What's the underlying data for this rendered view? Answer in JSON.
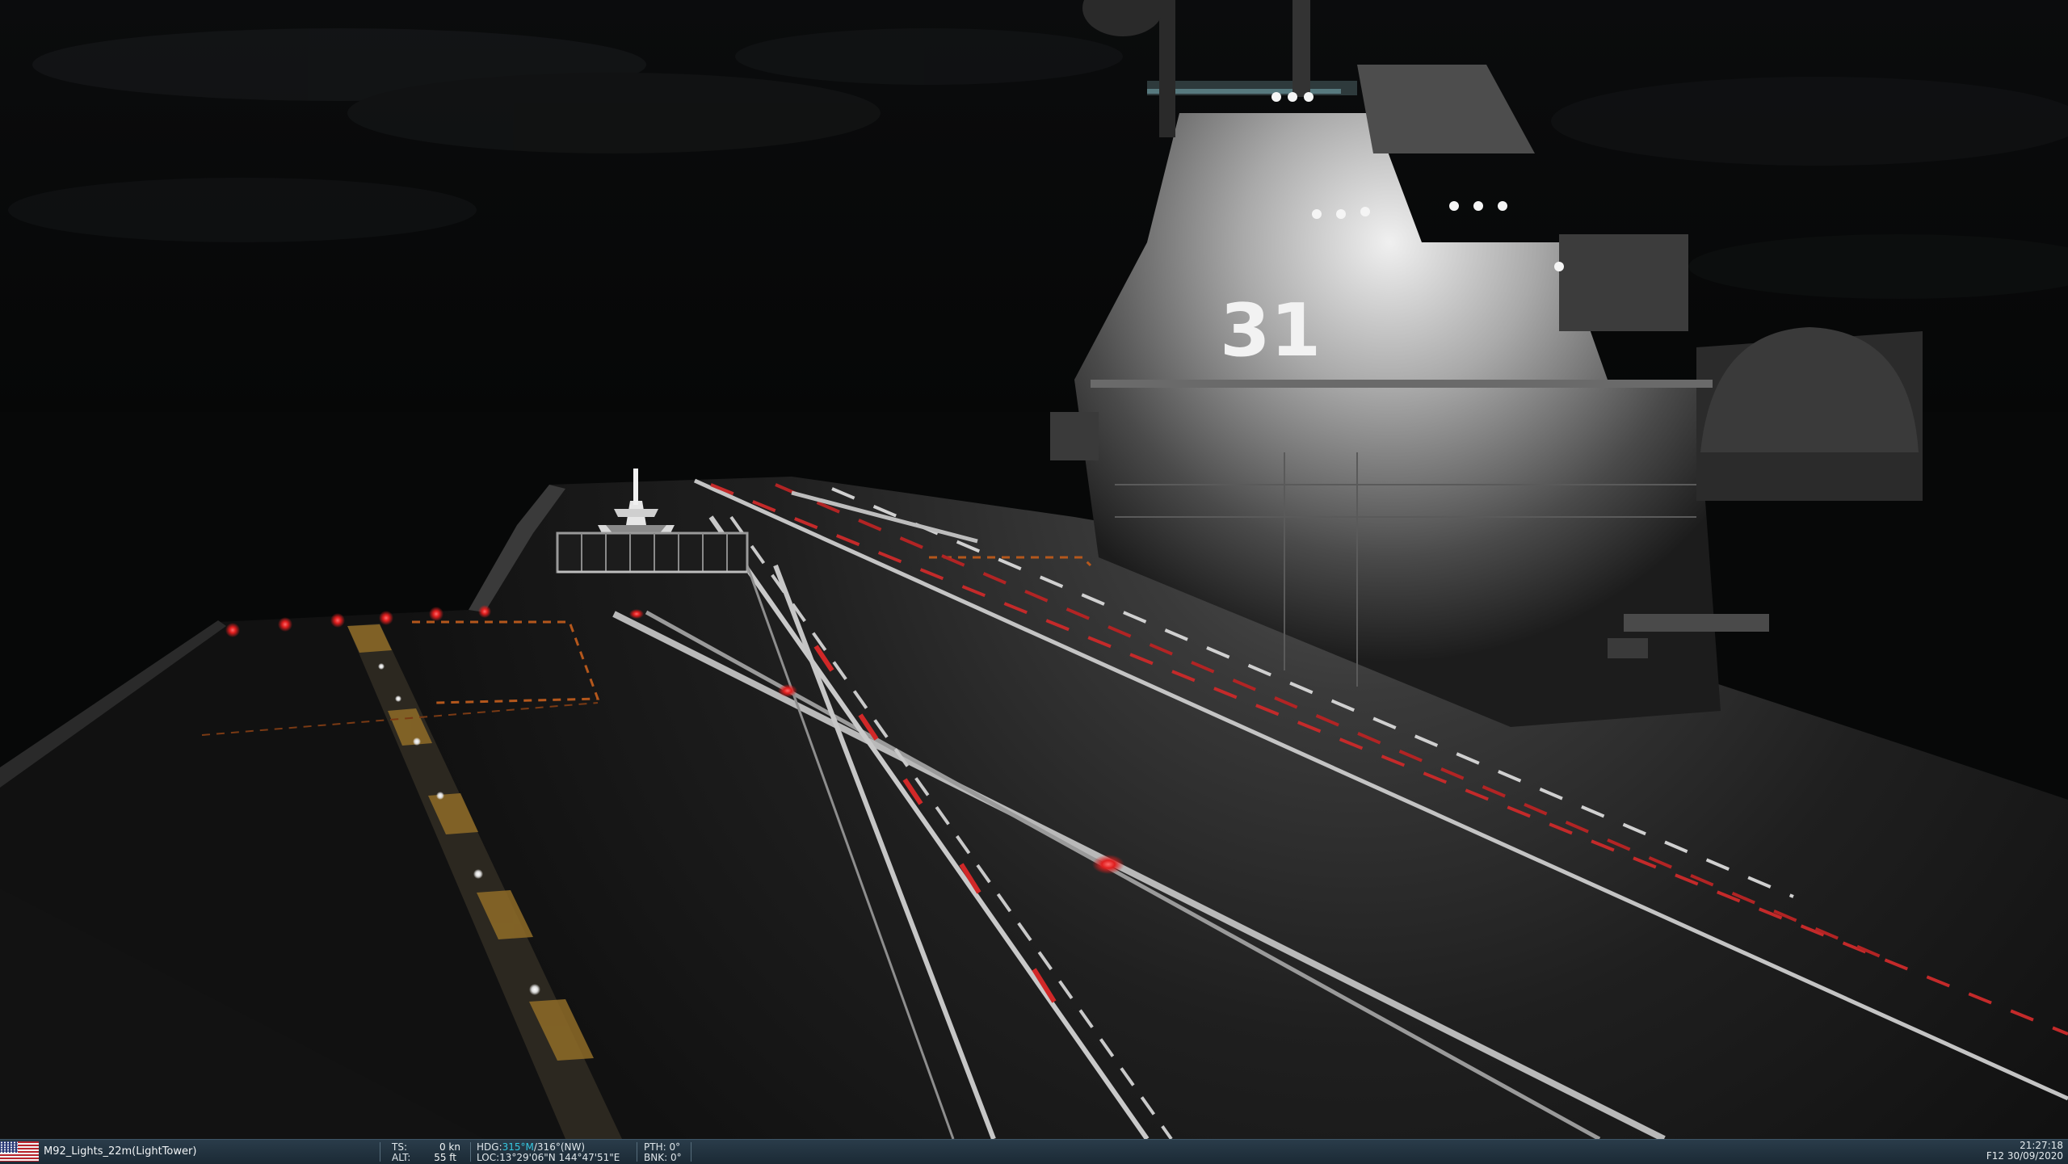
{
  "scene": {
    "hull_number": "31"
  },
  "status_bar": {
    "mission_text": "M92_Lights_22m(LightTower)",
    "ts_label": "TS:",
    "ts_value": "0 kn",
    "alt_label": "ALT:",
    "alt_value": "55 ft",
    "hdg_label": "HDG:",
    "hdg_magnetic": "315°M",
    "hdg_true": "/316°(NW)",
    "loc_label": "LOC:",
    "loc_value": "13°29'06\"N 144°47'51\"E",
    "pth_label": "PTH:",
    "pth_value": "0°",
    "bnk_label": "BNK:",
    "bnk_value": "0°",
    "time": "21:27:18",
    "date": "F12 30/09/2020"
  },
  "colors": {
    "status_bar_bg": "#1f2f3b",
    "heading_highlight": "#36c7e0",
    "deck_light_red": "#ff2a2a",
    "deck_light_white": "#ffffff",
    "deck_stripe_yellow": "#c9952e"
  }
}
